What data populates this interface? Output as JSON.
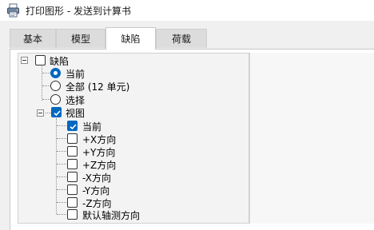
{
  "window": {
    "title": "打印图形 - 发送到计算书",
    "icon": "printer-icon"
  },
  "tabs": [
    {
      "label": "基本",
      "active": false
    },
    {
      "label": "模型",
      "active": false
    },
    {
      "label": "缺陷",
      "active": true
    },
    {
      "label": "荷载",
      "active": false
    }
  ],
  "tree": {
    "root": {
      "label": "缺陷",
      "checked": false,
      "expanded": true
    },
    "options": [
      {
        "label": "当前",
        "selected": true
      },
      {
        "label": "全部 (12 单元)",
        "selected": false
      },
      {
        "label": "选择",
        "selected": false
      }
    ],
    "views": {
      "label": "视图",
      "checked": true,
      "expanded": true,
      "items": [
        {
          "label": "当前",
          "checked": true
        },
        {
          "label": "+X方向",
          "checked": false
        },
        {
          "label": "+Y方向",
          "checked": false
        },
        {
          "label": "+Z方向",
          "checked": false
        },
        {
          "label": "-X方向",
          "checked": false
        },
        {
          "label": "-Y方向",
          "checked": false
        },
        {
          "label": "-Z方向",
          "checked": false
        },
        {
          "label": "默认轴测方向",
          "checked": false
        }
      ]
    }
  },
  "colors": {
    "accent": "#0067c0"
  }
}
